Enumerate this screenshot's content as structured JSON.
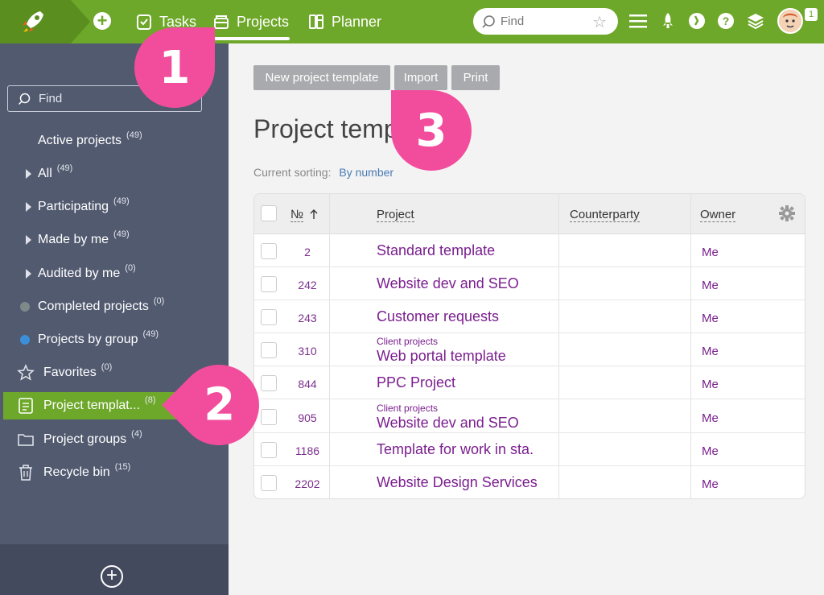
{
  "topbar": {
    "nav": [
      {
        "label": "Tasks"
      },
      {
        "label": "Projects"
      },
      {
        "label": "Planner"
      }
    ],
    "search_placeholder": "Find",
    "notification_count": "1"
  },
  "sidebar": {
    "search_placeholder": "Find",
    "items": [
      {
        "label": "Active projects",
        "count": "(49)"
      },
      {
        "label": "All",
        "count": "(49)"
      },
      {
        "label": "Participating",
        "count": "(49)"
      },
      {
        "label": "Made by me",
        "count": "(49)"
      },
      {
        "label": "Audited by me",
        "count": "(0)"
      },
      {
        "label": "Completed projects",
        "count": "(0)"
      },
      {
        "label": "Projects by group",
        "count": "(49)"
      },
      {
        "label": "Favorites",
        "count": "(0)"
      },
      {
        "label": "Project templat...",
        "count": "(8)"
      },
      {
        "label": "Project groups",
        "count": "(4)"
      },
      {
        "label": "Recycle bin",
        "count": "(15)"
      }
    ]
  },
  "toolbar": {
    "new_template": "New project template",
    "import": "Import",
    "print": "Print"
  },
  "page": {
    "title": "Project temp",
    "sorting_label": "Current sorting:",
    "sorting_value": "By number"
  },
  "table": {
    "headers": {
      "number": "№",
      "project": "Project",
      "counterparty": "Counterparty",
      "owner": "Owner"
    },
    "rows": [
      {
        "num": "2",
        "group": "",
        "name": "Standard template",
        "owner": "Me"
      },
      {
        "num": "242",
        "group": "",
        "name": "Website dev and SEO",
        "owner": "Me"
      },
      {
        "num": "243",
        "group": "",
        "name": "Customer requests",
        "owner": "Me"
      },
      {
        "num": "310",
        "group": "Client projects",
        "name": "Web portal template",
        "owner": "Me"
      },
      {
        "num": "844",
        "group": "",
        "name": "PPC Project",
        "owner": "Me"
      },
      {
        "num": "905",
        "group": "Client projects",
        "name": "Website dev and SEO",
        "owner": "Me"
      },
      {
        "num": "1186",
        "group": "",
        "name": "Template for work in sta.",
        "owner": "Me"
      },
      {
        "num": "2202",
        "group": "",
        "name": "Website Design Services",
        "owner": "Me"
      }
    ]
  },
  "callouts": [
    "1",
    "2",
    "3"
  ],
  "colors": {
    "accent": "#6ea82a",
    "sidebar": "#525a70",
    "callout": "#f24d9c",
    "link": "#7a1e8e"
  }
}
